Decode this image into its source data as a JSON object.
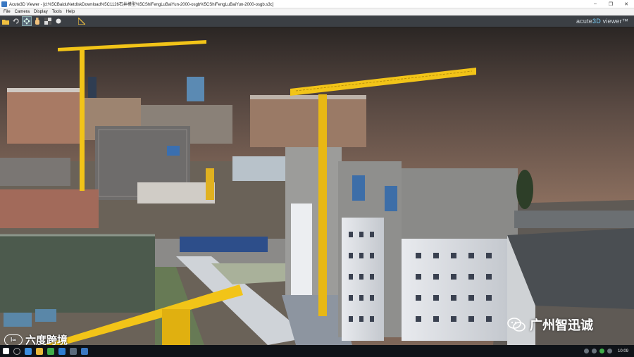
{
  "window": {
    "title": "Acute3D Viewer - [d:%5CBaiduNetdiskDownload%5C1126石井模型%5CShiFengLuBaiYun-2000-osgb%5CShiFengLuBaiYun-2000-osgb.s3c]",
    "controls": [
      "–",
      "❐",
      "✕"
    ]
  },
  "menu": [
    "File",
    "Camera",
    "Display",
    "Tools",
    "Help"
  ],
  "toolbar": {
    "tools": [
      "folder-open",
      "undo",
      "pan",
      "hand",
      "grid",
      "light",
      "measure"
    ],
    "brand_prefix": "acute",
    "brand_number": "3D",
    "brand_suffix": " viewer™"
  },
  "watermarks": {
    "left_logo": "l∞",
    "left_text": "六度跨境",
    "right_text": "广州智迅诚"
  },
  "taskbar": {
    "time": "10:09"
  },
  "colors": {
    "crane": "#f2c418",
    "sky_top": "#2a2624",
    "sky_bottom": "#8b6f5e",
    "toolbar": "#3b3f44"
  }
}
